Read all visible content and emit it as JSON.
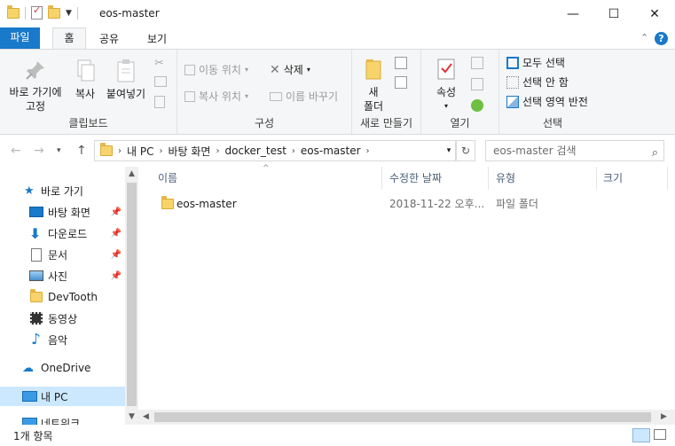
{
  "window": {
    "title": "eos-master",
    "minimize_glyph": "—",
    "maximize_glyph": "☐",
    "close_glyph": "✕"
  },
  "ribbon_tabs": {
    "file": "파일",
    "home": "홈",
    "share": "공유",
    "view": "보기",
    "collapse_glyph": "⌃",
    "help_glyph": "?"
  },
  "ribbon": {
    "clipboard": {
      "pin_quick_access": [
        "바로 가기에",
        "고정"
      ],
      "copy": "복사",
      "paste": "붙여넣기",
      "group_label": "클립보드"
    },
    "organize": {
      "move_to": "이동 위치",
      "copy_to": "복사 위치",
      "delete": "삭제",
      "rename": "이름 바꾸기",
      "group_label": "구성"
    },
    "new": {
      "new_folder": [
        "새",
        "폴더"
      ],
      "group_label": "새로 만들기"
    },
    "open": {
      "properties": "속성",
      "group_label": "열기"
    },
    "select": {
      "select_all": "모두 선택",
      "select_none": "선택 안 함",
      "invert_selection": "선택 영역 반전",
      "group_label": "선택"
    }
  },
  "address": {
    "breadcrumbs": [
      "내 PC",
      "바탕 화면",
      "docker_test",
      "eos-master"
    ],
    "search_placeholder": "eos-master 검색"
  },
  "nav_pane": {
    "quick_access": "바로 가기",
    "items": [
      {
        "label": "바탕 화면",
        "pinned": true
      },
      {
        "label": "다운로드",
        "pinned": true
      },
      {
        "label": "문서",
        "pinned": true
      },
      {
        "label": "사진",
        "pinned": true
      },
      {
        "label": "DevTooth",
        "pinned": false
      },
      {
        "label": "동영상",
        "pinned": false
      },
      {
        "label": "음악",
        "pinned": false
      }
    ],
    "onedrive": "OneDrive",
    "this_pc": "내 PC",
    "network": "네트워크"
  },
  "columns": {
    "name": "이름",
    "modified": "수정한 날짜",
    "type": "유형",
    "size": "크기"
  },
  "files": [
    {
      "name": "eos-master",
      "modified": "2018-11-22 오후...",
      "type": "파일 폴더",
      "size": ""
    }
  ],
  "status": {
    "item_count": "1개 항목"
  },
  "colors": {
    "accent": "#1979ca",
    "selection": "#cce8ff",
    "folder": "#f7d36b"
  }
}
